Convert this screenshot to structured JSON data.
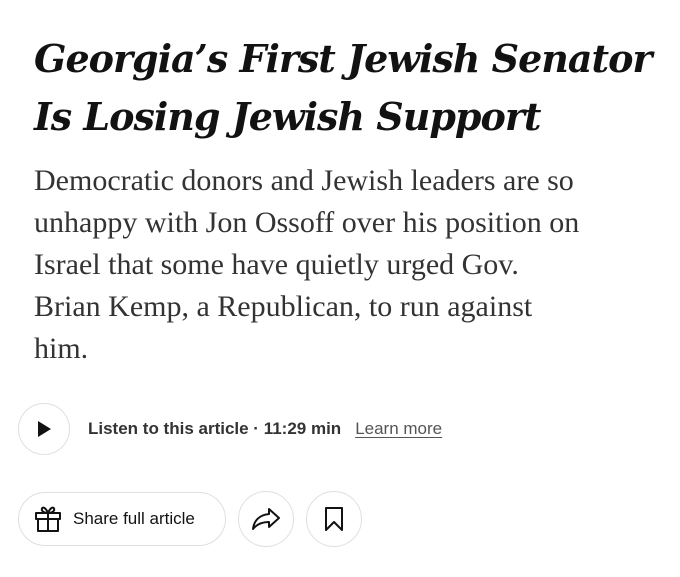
{
  "article": {
    "headline_lines": [
      "Georgia’s First Jewish Senator",
      "Is Losing Jewish Support"
    ],
    "summary_lines": [
      "Democratic donors and Jewish leaders are so",
      "unhappy with Jon Ossoff over his position on",
      "Israel that some have quietly urged Gov.",
      "Brian Kemp, a Republican, to run against",
      "him."
    ]
  },
  "audio": {
    "listen_text": "Listen to this article · 11:29 min",
    "learn_more": "Learn more"
  },
  "actions": {
    "share_label": "Share full article"
  },
  "icons": {
    "play": "play-icon",
    "gift": "gift-icon",
    "share": "share-arrow-icon",
    "bookmark": "bookmark-icon"
  }
}
